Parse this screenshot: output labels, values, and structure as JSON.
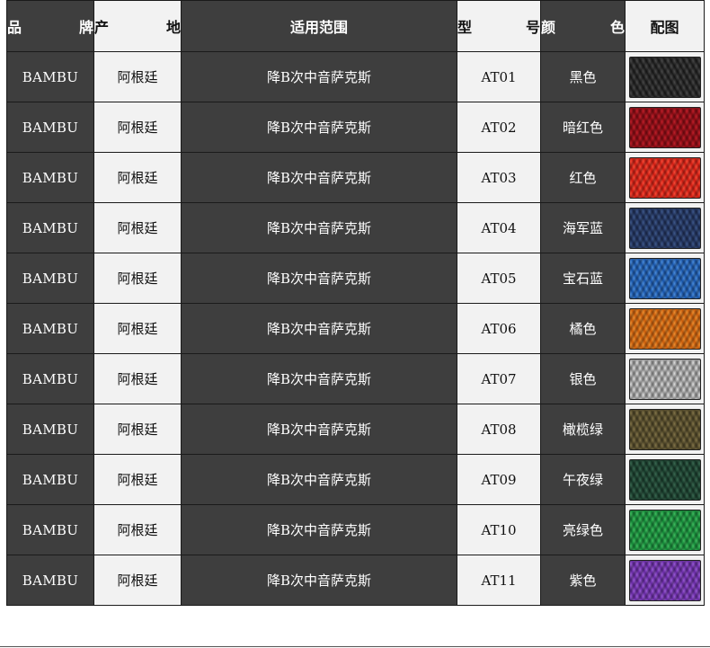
{
  "headers": {
    "brand": "品 牌",
    "origin": "产 地",
    "usage": "适用范围",
    "model": "型 号",
    "color": "颜 色",
    "image": "配图"
  },
  "rows": [
    {
      "brand": "BAMBU",
      "origin": "阿根廷",
      "usage": "降B次中音萨克斯",
      "model": "AT01",
      "color": "黑色",
      "swatch": "#1c1c1c",
      "swatch_light": "#4a4a4a"
    },
    {
      "brand": "BAMBU",
      "origin": "阿根廷",
      "usage": "降B次中音萨克斯",
      "model": "AT02",
      "color": "暗红色",
      "swatch": "#8a0a12",
      "swatch_light": "#c21f2a"
    },
    {
      "brand": "BAMBU",
      "origin": "阿根廷",
      "usage": "降B次中音萨克斯",
      "model": "AT03",
      "color": "红色",
      "swatch": "#d91c12",
      "swatch_light": "#ff4a36"
    },
    {
      "brand": "BAMBU",
      "origin": "阿根廷",
      "usage": "降B次中音萨克斯",
      "model": "AT04",
      "color": "海军蓝",
      "swatch": "#1f2f5a",
      "swatch_light": "#3f5a8e"
    },
    {
      "brand": "BAMBU",
      "origin": "阿根廷",
      "usage": "降B次中音萨克斯",
      "model": "AT05",
      "color": "宝石蓝",
      "swatch": "#1857b0",
      "swatch_light": "#4a8ee0"
    },
    {
      "brand": "BAMBU",
      "origin": "阿根廷",
      "usage": "降B次中音萨克斯",
      "model": "AT06",
      "color": "橘色",
      "swatch": "#d4600a",
      "swatch_light": "#f29030"
    },
    {
      "brand": "BAMBU",
      "origin": "阿根廷",
      "usage": "降B次中音萨克斯",
      "model": "AT07",
      "color": "银色",
      "swatch": "#9a9a9a",
      "swatch_light": "#e2e2e2"
    },
    {
      "brand": "BAMBU",
      "origin": "阿根廷",
      "usage": "降B次中音萨克斯",
      "model": "AT08",
      "color": "橄榄绿",
      "swatch": "#4e4526",
      "swatch_light": "#84764a"
    },
    {
      "brand": "BAMBU",
      "origin": "阿根廷",
      "usage": "降B次中音萨克斯",
      "model": "AT09",
      "color": "午夜绿",
      "swatch": "#173a2a",
      "swatch_light": "#3a6a52"
    },
    {
      "brand": "BAMBU",
      "origin": "阿根廷",
      "usage": "降B次中音萨克斯",
      "model": "AT10",
      "color": "亮绿色",
      "swatch": "#138a38",
      "swatch_light": "#3fc060"
    },
    {
      "brand": "BAMBU",
      "origin": "阿根廷",
      "usage": "降B次中音萨克斯",
      "model": "AT11",
      "color": "紫色",
      "swatch": "#6a2aa8",
      "swatch_light": "#9a5ad8"
    }
  ]
}
